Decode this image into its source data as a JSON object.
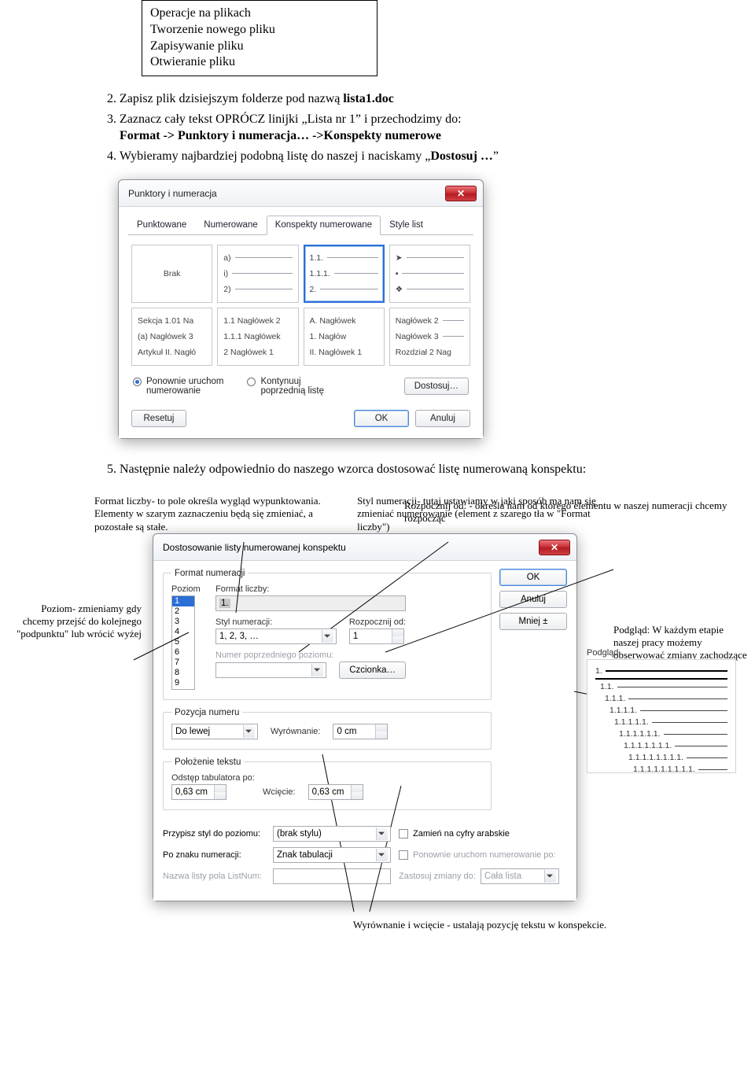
{
  "top_box": {
    "l1": "Operacje na plikach",
    "l2": "Tworzenie nowego pliku",
    "l3": "Zapisywanie pliku",
    "l4": "Otwieranie pliku"
  },
  "steps": {
    "s2_a": "Zapisz plik dzisiejszym folderze pod nazwą ",
    "s2_b": "lista1.doc",
    "s3_a": "Zaznacz cały tekst OPRÓCZ linijki „Lista nr 1” i przechodzimy do:",
    "s3_b1": "Format -> Punktory i numeracja… ->Konspekty numerowe",
    "s4_a": "Wybieramy najbardziej podobną listę do naszej i naciskamy „",
    "s4_b": "Dostosuj …",
    "s4_c": "”",
    "s5": "Następnie należy odpowiednio do naszego wzorca dostosować listę numerowaną konspektu:"
  },
  "dlg1": {
    "title": "Punktory i numeracja",
    "tabs": {
      "t1": "Punktowane",
      "t2": "Numerowane",
      "t3": "Konspekty numerowane",
      "t4": "Style list"
    },
    "none": "Brak",
    "row1c2": {
      "a": "a)",
      "b": "i)",
      "c": "2)"
    },
    "row1c3": {
      "a": "1.1.",
      "b": "1.1.1.",
      "c": "2."
    },
    "row1c4": {
      "a": "➤",
      "b": "▪",
      "c": "❖"
    },
    "row2c1": {
      "a": "Sekcja 1.01 Na",
      "b": "(a) Nagłówek 3",
      "c": "Artykuł II. Nagłó"
    },
    "row2c2": {
      "a": "1.1 Nagłówek 2",
      "b": "1.1.1 Nagłówek",
      "c": "2 Nagłówek 1"
    },
    "row2c3": {
      "a": "A. Nagłówek",
      "b": "1. Nagłów",
      "c": "II. Nagłówek 1"
    },
    "row2c4": {
      "a": "Nagłówek 2",
      "b": "Nagłówek 3",
      "c": "Rozdział 2 Nag"
    },
    "radio1_l1": "Ponownie uruchom",
    "radio1_l2": "numerowanie",
    "radio2_l1": "Kontynuuj",
    "radio2_l2": "poprzednią listę",
    "btn_custom": "Dostosuj…",
    "btn_reset": "Resetuj",
    "btn_ok": "OK",
    "btn_cancel": "Anuluj"
  },
  "annot": {
    "top_left": "Format liczby- to pole określa wygląd wypunktowania. Elementy w szarym zaznaczeniu będą się zmieniać, a pozostałe są stałe.",
    "top_mid": "Styl numeracji- tutaj ustawiamy w jaki sposób ma nam się zmieniać numerowanie (element z szarego tła w \"Format liczby\")",
    "top_right": "Rozpocznij od: - określa nam od którego elementu w naszej numeracji chcemy rozpocząć",
    "left": "Poziom- zmieniamy gdy chcemy przejść do kolejnego \"podpunktu\" lub wrócić wyżej",
    "right": "Podgląd: W każdym etapie naszej pracy możemy obserwować zmiany zachodzące w naszym konspekcie.",
    "bottom": "Wyrównanie i wcięcie - ustalają pozycję tekstu w konspekcie."
  },
  "dlg2": {
    "title": "Dostosowanie listy numerowanej konspektu",
    "grp_format": "Format numeracji",
    "lbl_level": "Poziom",
    "lbl_numfmt": "Format liczby:",
    "val_numfmt": "1.",
    "lbl_numstyle": "Styl numeracji:",
    "val_numstyle": "1, 2, 3, …",
    "lbl_startat": "Rozpocznij od:",
    "val_startat": "1",
    "lbl_prevnum": "Numer poprzedniego poziomu:",
    "btn_font": "Czcionka…",
    "grp_numpos": "Pozycja numeru",
    "val_align_combo": "Do lewej",
    "lbl_align": "Wyrównanie:",
    "val_align": "0 cm",
    "grp_textpos": "Położenie tekstu",
    "lbl_tabafter": "Odstęp tabulatora po:",
    "val_tabafter": "0,63 cm",
    "lbl_indent": "Wcięcie:",
    "val_indent": "0,63 cm",
    "lbl_preview": "Podgląd",
    "preview_lines": [
      "1.",
      "1.1.",
      "1.1.1.",
      "1.1.1.1.",
      "1.1.1.1.1.",
      "1.1.1.1.1.1.",
      "1.1.1.1.1.1.1.",
      "1.1.1.1.1.1.1.1.",
      "1.1.1.1.1.1.1.1.1."
    ],
    "lbl_assignstyle": "Przypisz styl do poziomu:",
    "val_assignstyle": "(brak stylu)",
    "lbl_arabic": "Zamień na cyfry arabskie",
    "lbl_afternum": "Po znaku numeracji:",
    "val_afternum": "Znak tabulacji",
    "lbl_restart": "Ponownie uruchom numerowanie po:",
    "lbl_listname": "Nazwa listy pola ListNum:",
    "lbl_applyto": "Zastosuj zmiany do:",
    "val_applyto": "Cała lista",
    "btn_ok": "OK",
    "btn_cancel": "Anuluj",
    "btn_less": "Mniej ±",
    "levels": [
      "1",
      "2",
      "3",
      "4",
      "5",
      "6",
      "7",
      "8",
      "9"
    ]
  }
}
